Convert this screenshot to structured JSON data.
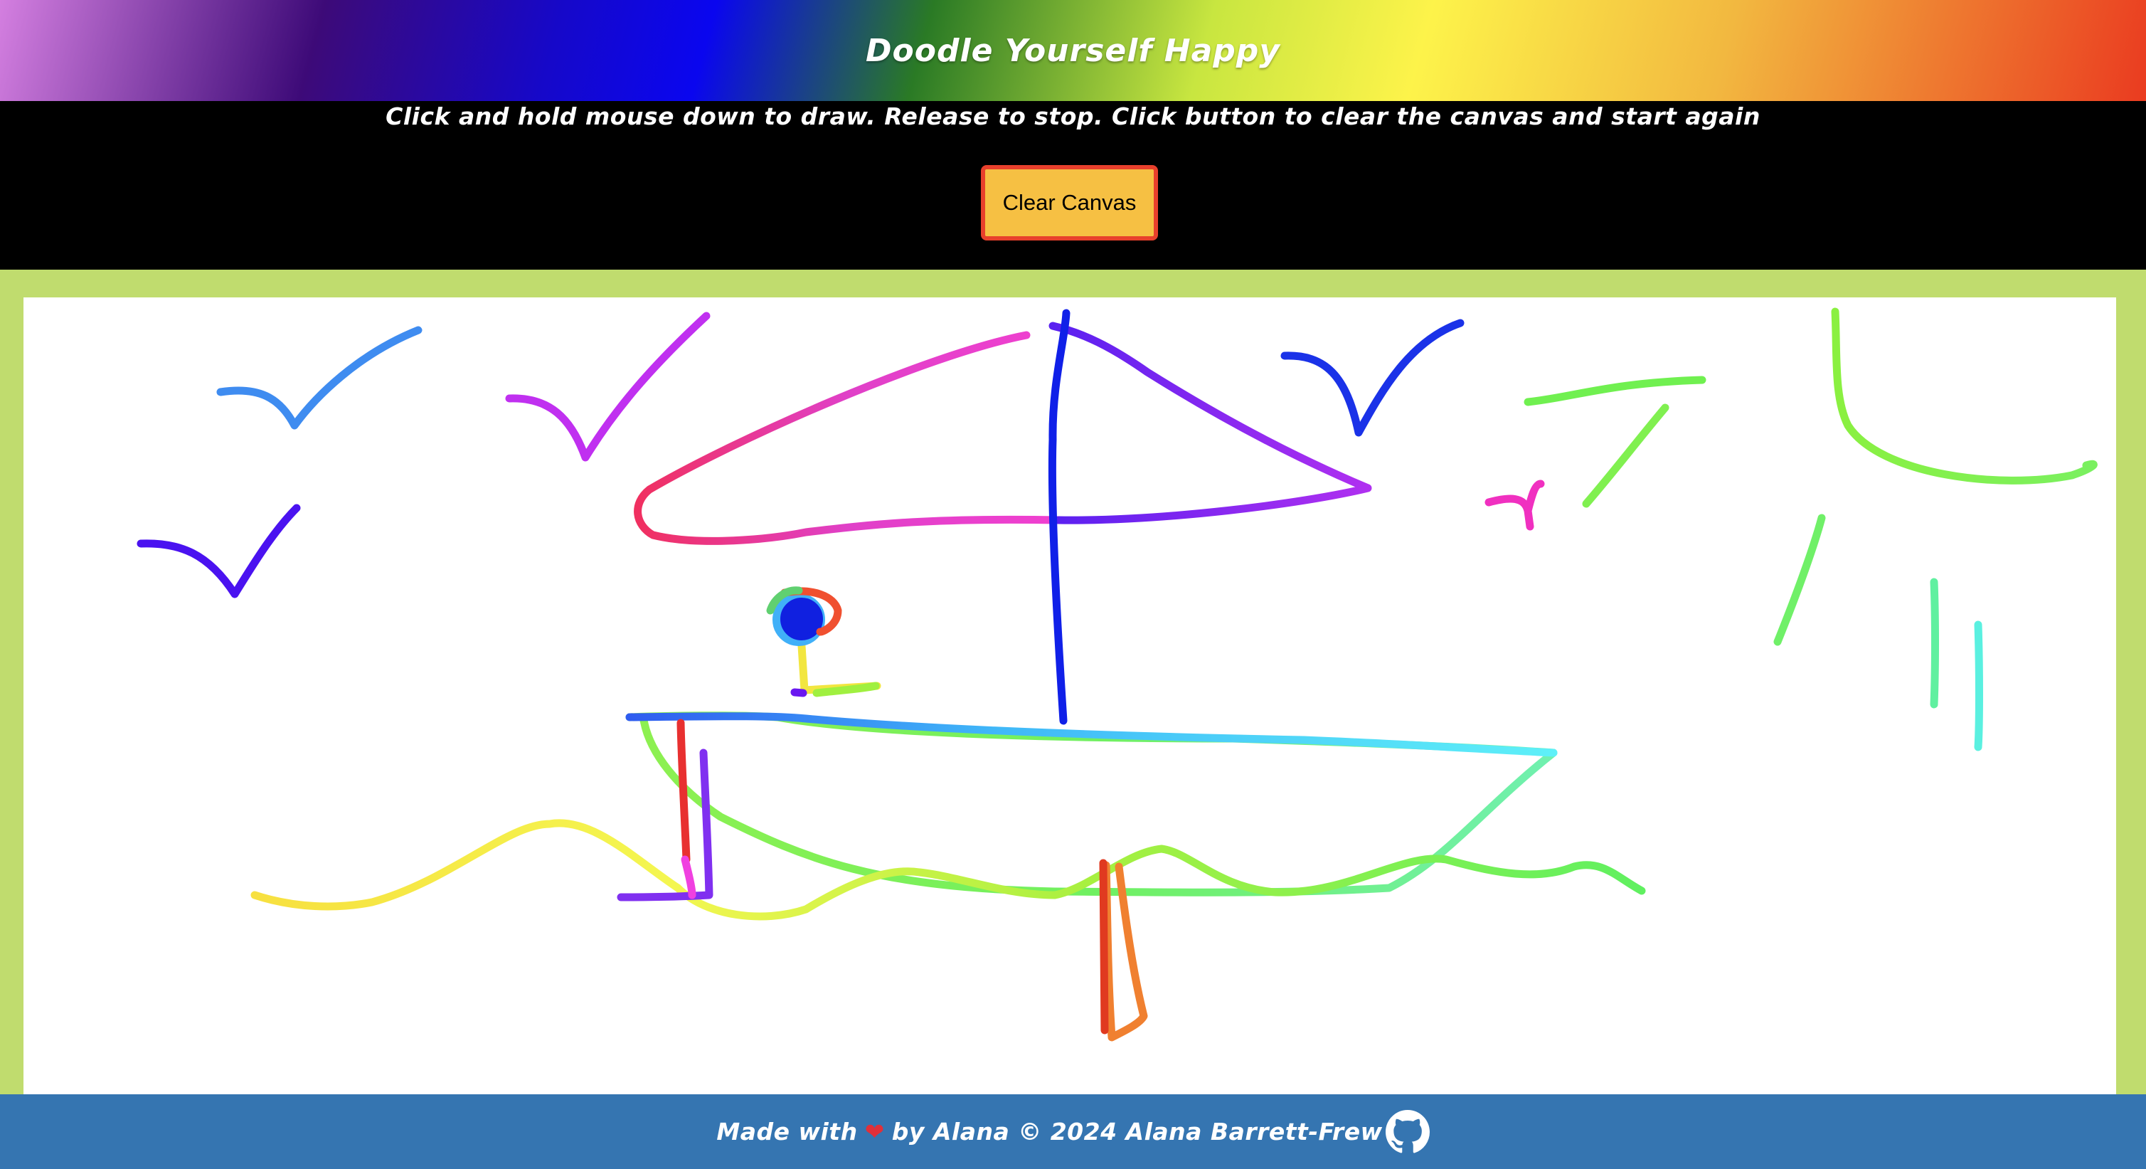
{
  "header": {
    "title": "Doodle Yourself Happy"
  },
  "controls": {
    "instructions": "Click and hold mouse down to draw. Release to stop. Click button to clear the canvas and start again",
    "clear_button_label": "Clear Canvas"
  },
  "canvas": {
    "content": "rainbow doodle of a sailboat on waves with birds and a sun"
  },
  "footer": {
    "made_with": "Made with",
    "heart_icon": "heart-icon",
    "by_text": "by Alana © 2024 Alana Barrett-Frew",
    "github_icon": "github-icon"
  },
  "colors": {
    "frame": "#c0dc6e",
    "footer": "#3575b1",
    "button_fill": "#f6c043",
    "button_border": "#e8402c"
  }
}
